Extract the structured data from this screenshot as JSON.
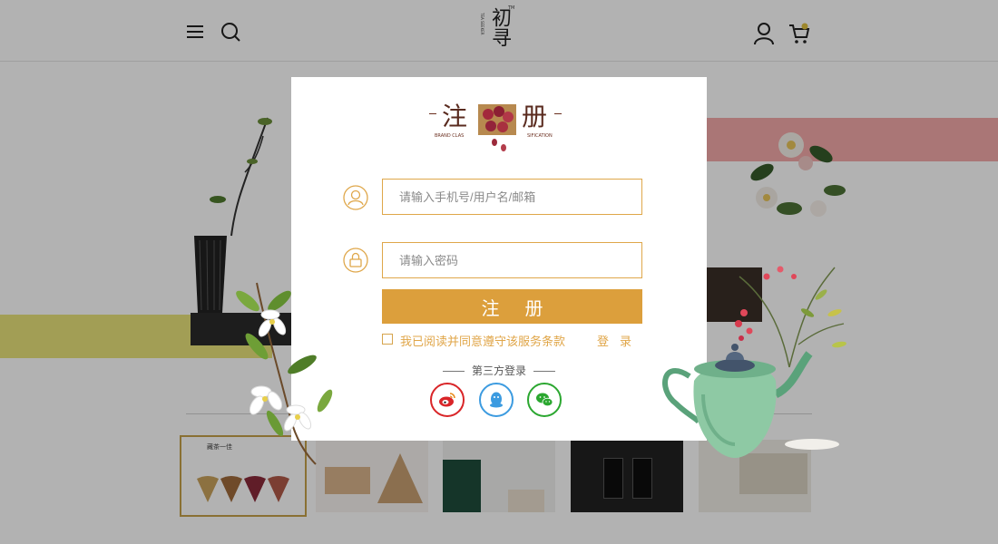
{
  "brand": {
    "logo_text": "初寻",
    "logo_mark": "TM",
    "logo_side": "TEA SEEKER"
  },
  "header": {
    "icons": [
      "menu-icon",
      "search-icon",
      "user-icon",
      "cart-icon"
    ]
  },
  "thumbnails": {
    "active_title": "藏茶一佳"
  },
  "modal": {
    "logo_left": "注",
    "logo_right": "册",
    "logo_sub_left": "BRAND CLAS",
    "logo_sub_right": "SIFICATION",
    "username_placeholder": "请输入手机号/用户名/邮箱",
    "password_placeholder": "请输入密码",
    "submit_label": "注册",
    "agree_label": "我已阅读并同意遵守该服务条款",
    "login_label": "登录",
    "third_party_label": "第三方登录",
    "social": [
      "weibo-icon",
      "qq-icon",
      "wechat-icon"
    ]
  },
  "colors": {
    "accent": "#dc9f3c",
    "field_border": "#dfa74a",
    "link": "#e0a649",
    "weibo": "#d92528",
    "qq": "#3c9be0",
    "wechat": "#2ba730"
  }
}
